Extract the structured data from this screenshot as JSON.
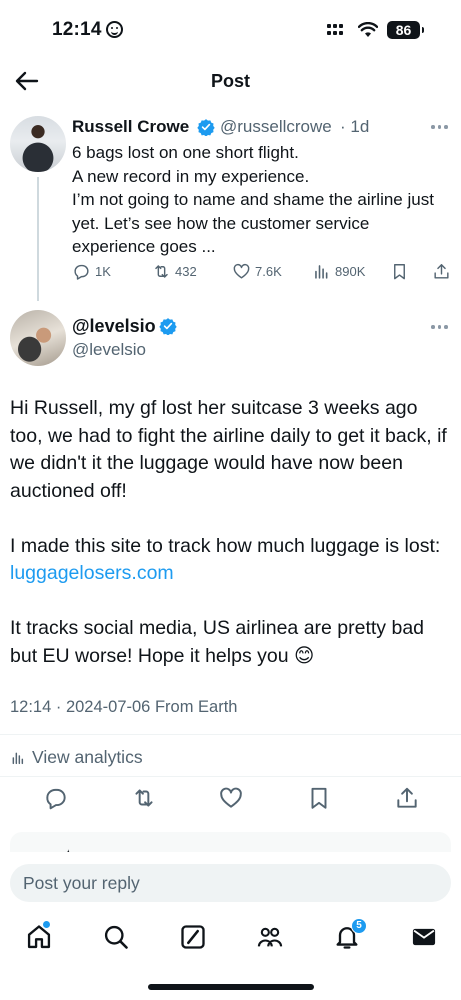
{
  "status_bar": {
    "time": "12:14",
    "battery": "86"
  },
  "header": {
    "title": "Post",
    "back_icon": "arrow-left-icon"
  },
  "parent_post": {
    "name": "Russell Crowe",
    "handle": "@russellcrowe",
    "time": "· 1d",
    "text": "6 bags lost on one short flight.\nA new record in my experience.\nI’m not going to name and shame the airline just yet. Let’s see how the customer service experience goes ...",
    "replies": "1K",
    "reposts": "432",
    "likes": "7.6K",
    "views": "890K"
  },
  "main_post": {
    "name": "@levelsio",
    "handle": "@levelsio",
    "paragraph1": "Hi Russell, my gf lost her suitcase 3 weeks ago too, we had to fight the airline daily to get it back, if we didn't it the luggage would have now been auctioned off!",
    "paragraph2_prefix": "I made this site to track how much luggage is lost: ",
    "paragraph2_link": "luggagelosers.com",
    "paragraph3": "It tracks social media, US airlinea are pretty bad but EU worse! Hope it helps you 😊",
    "timestamp": "12:14 · 2024-07-06 From Earth"
  },
  "analytics": {
    "label": "View analytics"
  },
  "reply": {
    "placeholder": "Post your reply"
  },
  "tabbar": {
    "notifications_badge": "5"
  },
  "colors": {
    "accent": "#1d9bf0",
    "text": "#0f1419",
    "secondary": "#536471"
  }
}
